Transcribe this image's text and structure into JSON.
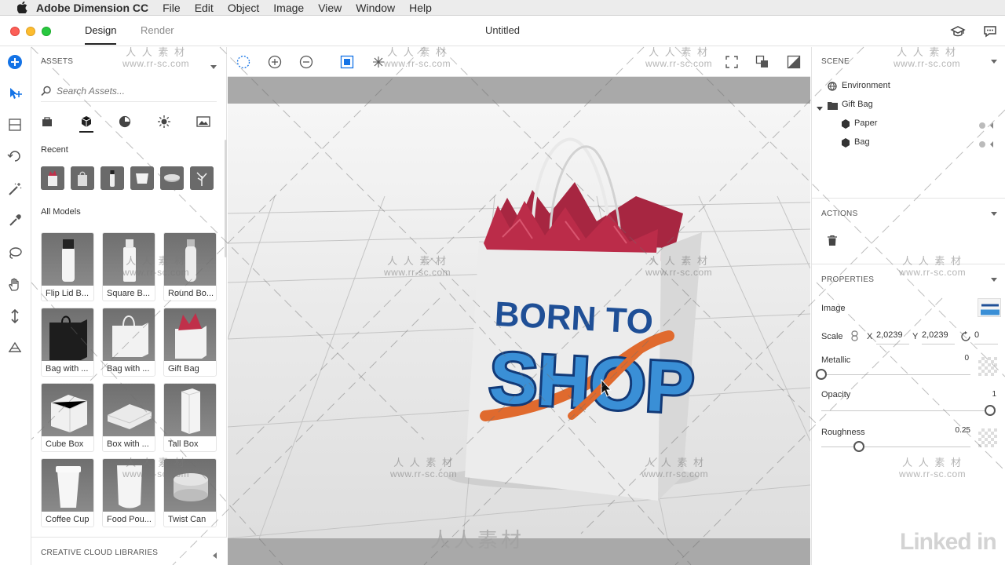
{
  "menubar": {
    "app_name": "Adobe Dimension CC",
    "items": [
      "File",
      "Edit",
      "Object",
      "Image",
      "View",
      "Window",
      "Help"
    ]
  },
  "titlebar": {
    "tabs": {
      "design": "Design",
      "render": "Render"
    },
    "document_title": "Untitled"
  },
  "assets": {
    "header": "ASSETS",
    "search_placeholder": "Search Assets...",
    "recent_label": "Recent",
    "all_models_label": "All Models",
    "models": [
      "Flip Lid B...",
      "Square B...",
      "Round Bo...",
      "Bag with ...",
      "Bag with ...",
      "Gift Bag",
      "Cube Box",
      "Box with ...",
      "Tall Box",
      "Coffee Cup",
      "Food Pou...",
      "Twist Can"
    ],
    "libraries_label": "CREATIVE CLOUD LIBRARIES"
  },
  "canvas": {
    "bag_text_line1": "BORN TO",
    "bag_text_line2": "SHOP"
  },
  "scene": {
    "header": "SCENE",
    "items": {
      "environment": "Environment",
      "group": "Gift Bag",
      "child1": "Paper",
      "child2": "Bag"
    }
  },
  "actions": {
    "header": "ACTIONS"
  },
  "properties": {
    "header": "PROPERTIES",
    "image_label": "Image",
    "scale_label": "Scale",
    "scale_x_label": "X",
    "scale_x_value": "2,0239",
    "scale_y_label": "Y",
    "scale_y_value": "2,0239",
    "rotation_value": "0",
    "metallic_label": "Metallic",
    "metallic_value": "0",
    "metallic_level": 0,
    "opacity_label": "Opacity",
    "opacity_value": "1",
    "opacity_level": 1,
    "roughness_label": "Roughness",
    "roughness_value": "0.25",
    "roughness_level": 0.25
  },
  "watermark": {
    "cn": "人 人 素 材",
    "url": "www.rr-sc.com",
    "center_text": "人人素材",
    "brand": "Linked in"
  },
  "colors": {
    "accent_blue": "#1473e6",
    "traffic_red": "#fc5f57",
    "traffic_yellow": "#fdbc2e",
    "traffic_green": "#28c840",
    "tissue": "#b52a45",
    "print_blue": "#1f5da8",
    "print_navy": "#123a78",
    "print_orange": "#e06a2e"
  }
}
